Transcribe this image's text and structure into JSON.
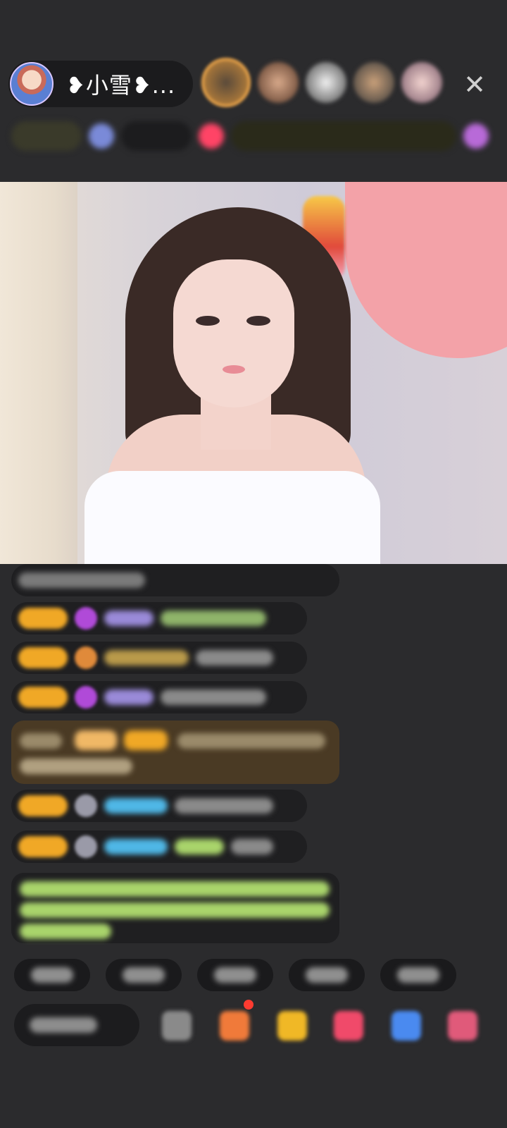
{
  "header": {
    "host_name": "❥小雪❥...",
    "close_icon": "✕"
  },
  "colors": {
    "background": "#2b2b2d",
    "badge_gold": "#f0a826",
    "accent_red": "#ff3b30",
    "chat_green": "#a9d46b",
    "chat_blue": "#4fb7e6"
  }
}
